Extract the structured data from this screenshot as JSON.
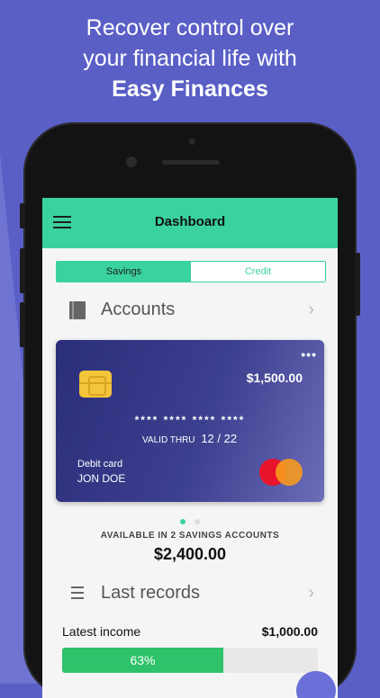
{
  "promo": {
    "line1": "Recover control over",
    "line2": "your financial life with",
    "line3": "Easy Finances"
  },
  "app": {
    "title": "Dashboard",
    "tabs": [
      {
        "label": "Savings",
        "active": true
      },
      {
        "label": "Credit",
        "active": false
      }
    ],
    "accounts": {
      "title": "Accounts"
    },
    "card": {
      "balance": "$1,500.00",
      "number": "**** **** **** ****",
      "valid_label": "VALID THRU",
      "valid_date": "12 / 22",
      "type": "Debit card",
      "holder": "JON DOE",
      "more": "•••"
    },
    "pager": {
      "count": 2,
      "active_index": 0
    },
    "summary": {
      "label": "AVAILABLE IN 2 SAVINGS ACCOUNTS",
      "amount": "$2,400.00"
    },
    "records": {
      "title": "Last records"
    },
    "income": {
      "label": "Latest income",
      "value": "$1,000.00",
      "progress_label": "63%",
      "progress_fraction": 0.63
    }
  },
  "colors": {
    "background": "#5a5fc6",
    "accent": "#3ad29f",
    "progress": "#2ec26a"
  }
}
